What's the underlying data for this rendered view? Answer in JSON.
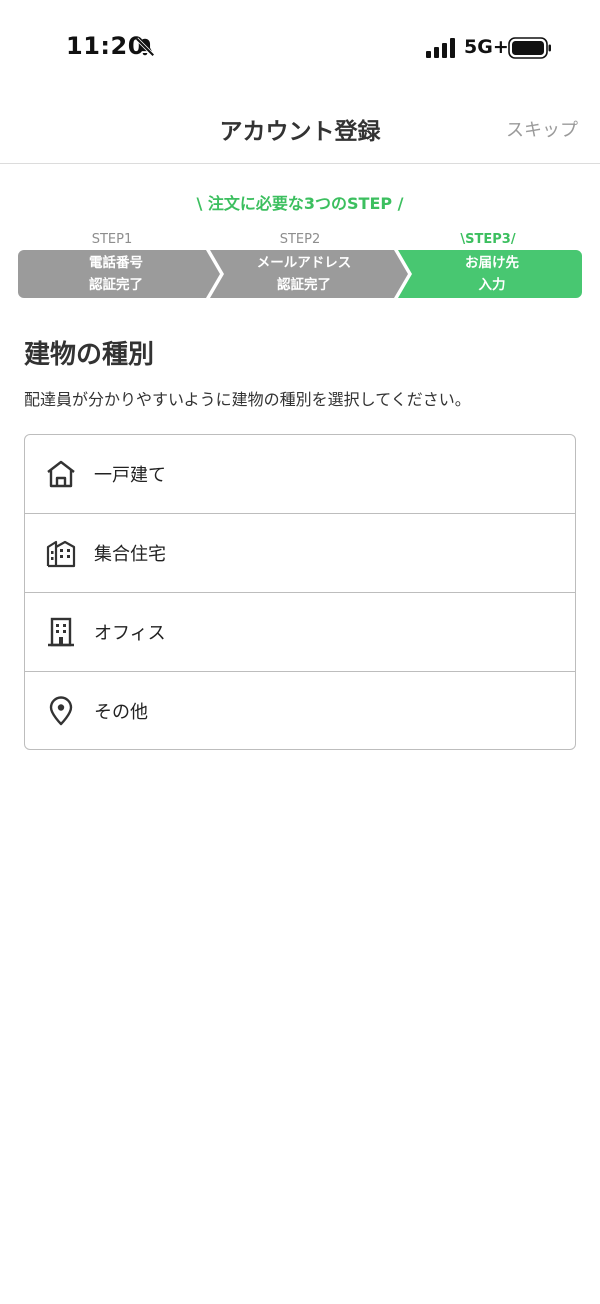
{
  "status_bar": {
    "time": "11:20",
    "network": "5G+",
    "icons": [
      "bell-slash-icon",
      "signal-icon",
      "battery-icon"
    ]
  },
  "header": {
    "title": "アカウント登録",
    "skip_label": "スキップ"
  },
  "steps": {
    "caption": "\\ 注文に必要な3つのSTEP /",
    "items": [
      {
        "label": "STEP1",
        "line1": "電話番号",
        "line2": "認証完了",
        "state": "done"
      },
      {
        "label": "STEP2",
        "line1": "メールアドレス",
        "line2": "認証完了",
        "state": "done"
      },
      {
        "label": "\\STEP3/",
        "line1": "お届け先",
        "line2": "入力",
        "state": "active"
      }
    ],
    "colors": {
      "done": "#9b9b9b",
      "active": "#48c771"
    }
  },
  "section": {
    "title": "建物の種別",
    "description": "配達員が分かりやすいように建物の種別を選択してください。"
  },
  "building_types": [
    {
      "label": "一戸建て",
      "icon": "house-icon"
    },
    {
      "label": "集合住宅",
      "icon": "apartment-icon"
    },
    {
      "label": "オフィス",
      "icon": "office-building-icon"
    },
    {
      "label": "その他",
      "icon": "location-pin-icon"
    }
  ]
}
